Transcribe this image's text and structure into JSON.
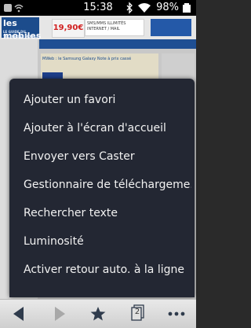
{
  "status_bar": {
    "time": "15:38",
    "battery": "98%",
    "icons": [
      "notification-icon",
      "wifi-notification-icon",
      "bluetooth-icon",
      "wifi-icon",
      "battery-icon"
    ]
  },
  "webpage": {
    "logo": "les mobiles",
    "logo_sub": "LE GUIDE DU TELEPHONE MOBILE",
    "ad_price": "19,90€",
    "ad_text": "SMS/MMS ILLIMITÉS INTERNET / MAIL",
    "article_title": "MWeb : le Samsung Galaxy Note à prix cassé"
  },
  "menu": {
    "items": [
      "Ajouter un favori",
      "Ajouter à l'écran d'accueil",
      "Envoyer vers Caster",
      "Gestionnaire de téléchargeme...",
      "Rechercher texte",
      "Luminosité",
      "Activer retour auto. à la ligne"
    ]
  },
  "toolbar": {
    "tab_count": "2",
    "buttons": [
      "back-icon",
      "forward-icon",
      "favorites-star-icon",
      "tabs-icon",
      "more-options-icon"
    ]
  },
  "colors": {
    "menu_bg": "#232733",
    "toolbar_bg": "#dcdcdc",
    "status_bar_bg": "#000000"
  }
}
